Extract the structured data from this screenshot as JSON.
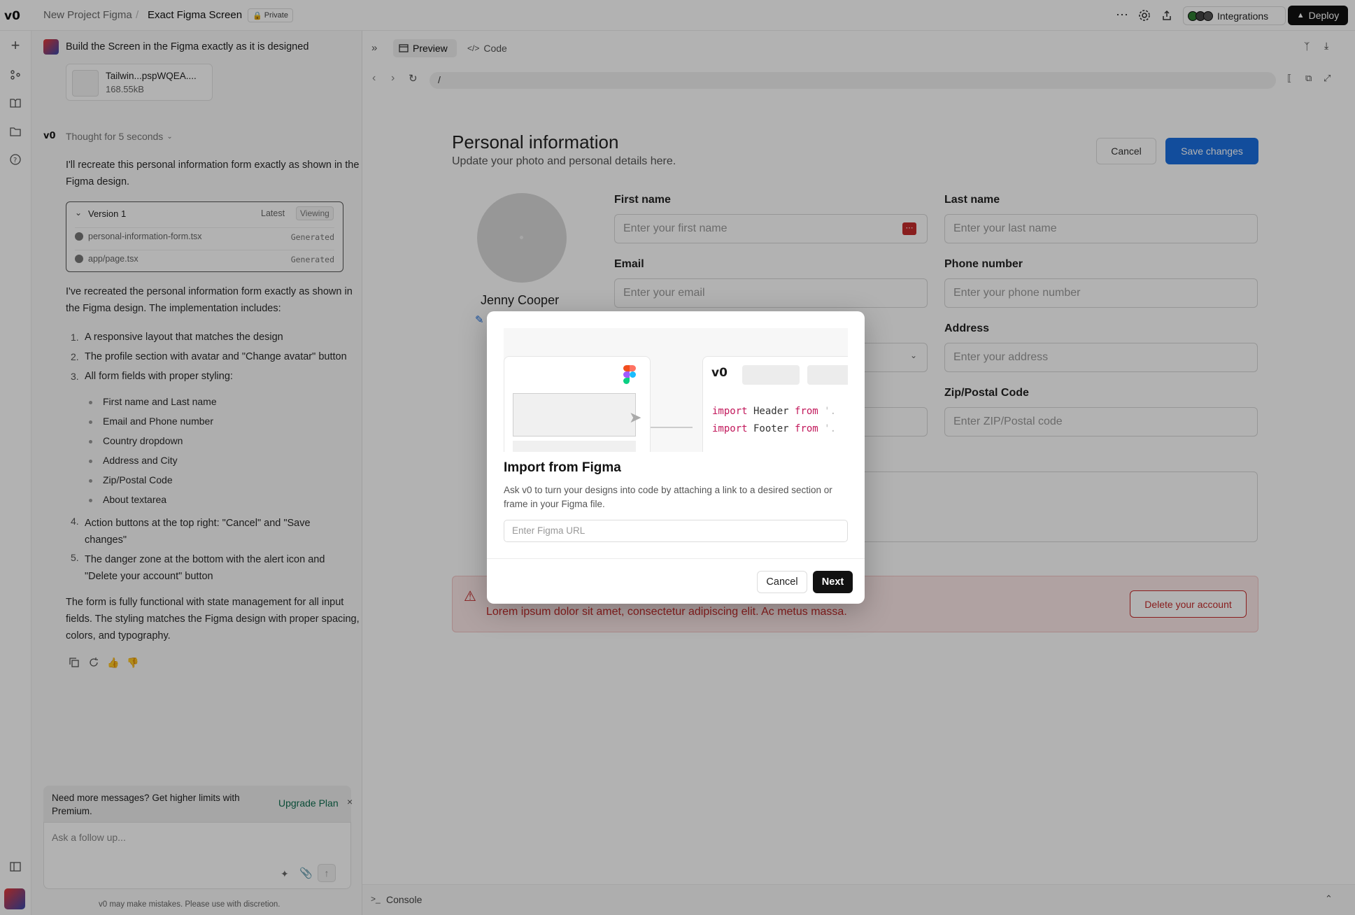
{
  "topbar": {
    "project": "New Project Figma",
    "separator": "/",
    "screen": "Exact Figma Screen",
    "private_badge": "Private",
    "integrations": "Integrations",
    "deploy": "Deploy"
  },
  "chat": {
    "prompt": "Build the Screen in the Figma exactly as it is designed",
    "attachment_name": "Tailwin...pspWQEA....",
    "attachment_size": "168.55kB",
    "thought": "Thought for 5 seconds",
    "intro": "I'll recreate this personal information form exactly as shown in the Figma design.",
    "version": {
      "title": "Version 1",
      "latest": "Latest",
      "viewing": "Viewing",
      "files": [
        {
          "name": "personal-information-form.tsx",
          "status": "Generated"
        },
        {
          "name": "app/page.tsx",
          "status": "Generated"
        }
      ]
    },
    "summary": "I've recreated the personal information form exactly as shown in the Figma design. The implementation includes:",
    "steps": [
      "A responsive layout that matches the design",
      "The profile section with avatar and \"Change avatar\" button",
      "All form fields with proper styling:",
      "Action buttons at the top right: \"Cancel\" and \"Save changes\"",
      "The danger zone at the bottom with the alert icon and \"Delete your account\" button"
    ],
    "step_numbers": [
      "1.",
      "2.",
      "3.",
      "4.",
      "5."
    ],
    "subitems": [
      "First name and Last name",
      "Email and Phone number",
      "Country dropdown",
      "Address and City",
      "Zip/Postal Code",
      "About textarea"
    ],
    "closing": "The form is fully functional with state management for all input fields. The styling matches the Figma design with proper spacing, colors, and typography.",
    "upgrade_text": "Need more messages? Get higher limits with Premium.",
    "upgrade_link": "Upgrade Plan",
    "input_placeholder": "Ask a follow up...",
    "disclaimer": "v0 may make mistakes. Please use with discretion."
  },
  "preview": {
    "tab_preview": "Preview",
    "tab_code": "Code",
    "url": "/",
    "console": "Console"
  },
  "form": {
    "title": "Personal information",
    "subtitle": "Update your photo and personal details here.",
    "cancel": "Cancel",
    "save": "Save changes",
    "user_name": "Jenny Cooper",
    "first_name_label": "First name",
    "first_name_placeholder": "Enter your first name",
    "last_name_label": "Last name",
    "last_name_placeholder": "Enter your last name",
    "email_label": "Email",
    "email_placeholder": "Enter your email",
    "phone_label": "Phone number",
    "phone_placeholder": "Enter your phone number",
    "address_label": "Address",
    "address_placeholder": "Enter your address",
    "zip_label": "Zip/Postal Code",
    "zip_placeholder": "Enter ZIP/Postal code",
    "danger_text": "Lorem ipsum dolor sit amet, consectetur adipiscing elit. Ac metus massa.",
    "delete_button": "Delete your account"
  },
  "modal": {
    "title": "Import from Figma",
    "description": "Ask v0 to turn your designs into code by attaching a link to a desired section or frame in your Figma file.",
    "input_placeholder": "Enter Figma URL",
    "cancel": "Cancel",
    "next": "Next",
    "code_line1_kw": "import",
    "code_line1_name": " Header ",
    "code_line1_from": "from",
    "code_line1_path": " '.",
    "code_line2_kw": "import",
    "code_line2_name": " Footer ",
    "code_line2_from": "from",
    "code_line2_path": " '."
  },
  "colors": {
    "accent": "#1b6fe0",
    "danger": "#c42b2b",
    "danger_bg": "#fde8e8",
    "upgrade": "#0f6e4f",
    "code_keyword": "#c2185b"
  }
}
